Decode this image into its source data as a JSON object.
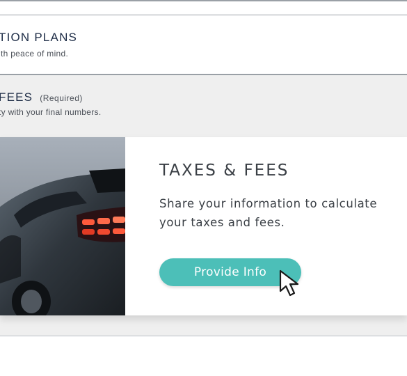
{
  "section_plans": {
    "title": "TION PLANS",
    "subtitle": "ith peace of mind."
  },
  "section_fees": {
    "title": "FEES",
    "required_tag": "(Required)",
    "subtitle": "ty with your final numbers."
  },
  "card": {
    "title": "TAXES & FEES",
    "description": "Share your information to calculate your taxes and fees.",
    "button_label": "Provide Info",
    "image_name": "car-photo",
    "accent_color": "#4cbfb8"
  },
  "cursor": {
    "icon": "pointer-cursor-icon"
  }
}
